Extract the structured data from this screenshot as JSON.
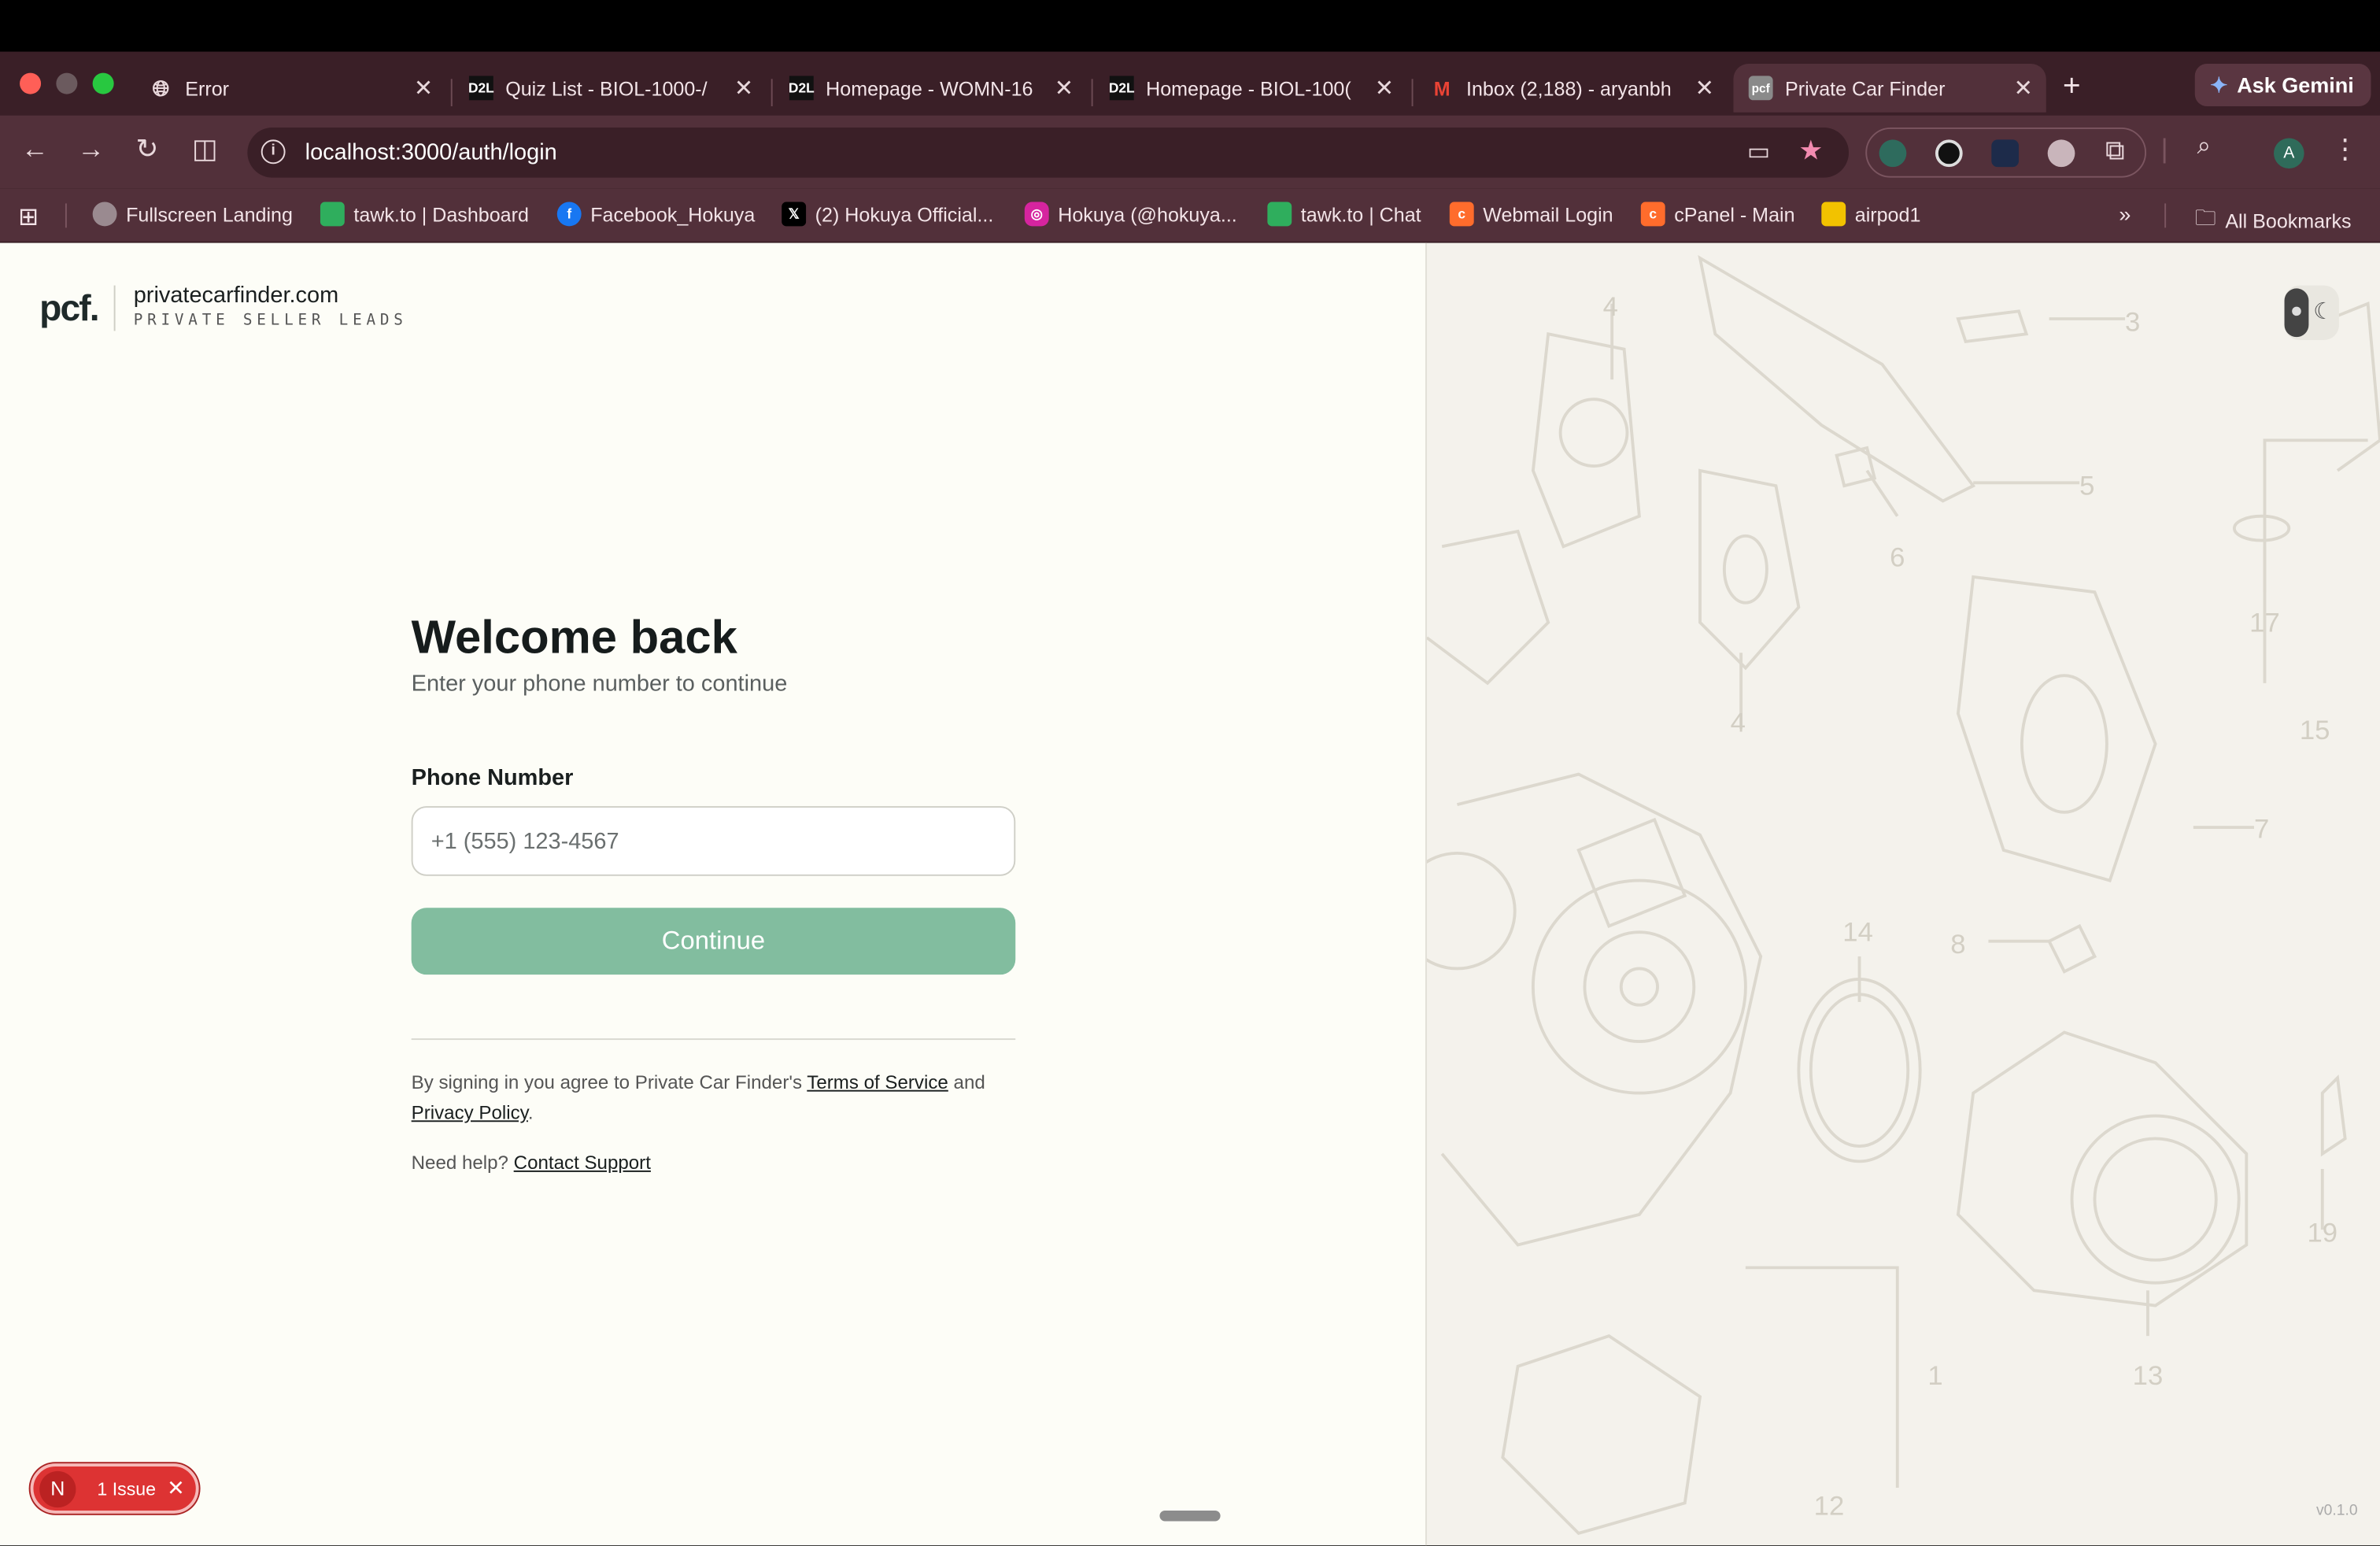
{
  "browser": {
    "tabs": [
      {
        "title": "Error",
        "favicon": "globe-icon"
      },
      {
        "title": "Quiz List - BIOL-1000-/",
        "favicon": "D2L"
      },
      {
        "title": "Homepage - WOMN-16",
        "favicon": "D2L"
      },
      {
        "title": "Homepage - BIOL-100(",
        "favicon": "D2L"
      },
      {
        "title": "Inbox (2,188) - aryanbh",
        "favicon": "M"
      },
      {
        "title": "Private Car Finder",
        "favicon": "pcf"
      }
    ],
    "ask_gemini": "Ask Gemini",
    "url": "localhost:3000/auth/login",
    "profile_initial": "A",
    "bookmarks": [
      {
        "label": "Fullscreen Landing",
        "color": "#9a8a90"
      },
      {
        "label": "tawk.to | Dashboard",
        "color": "#2fae5d"
      },
      {
        "label": "Facebook_Hokuya",
        "color": "#1877f2"
      },
      {
        "label": "(2) Hokuya Official...",
        "color": "#000000"
      },
      {
        "label": "Hokuya (@hokuya...",
        "color": "#d6249f"
      },
      {
        "label": "tawk.to | Chat",
        "color": "#2fae5d"
      },
      {
        "label": "Webmail Login",
        "color": "#ff6c2c"
      },
      {
        "label": "cPanel - Main",
        "color": "#ff6c2c"
      },
      {
        "label": "airpod1",
        "color": "#f2c200"
      }
    ],
    "all_bookmarks": "All Bookmarks"
  },
  "brand": {
    "mark": "pcf.",
    "domain": "privatecarfinder.com",
    "tagline": "PRIVATE SELLER LEADS"
  },
  "login": {
    "title": "Welcome back",
    "subtitle": "Enter your phone number to continue",
    "phone_label": "Phone Number",
    "phone_placeholder": "+1 (555) 123-4567",
    "continue_label": "Continue",
    "legal_prefix": "By signing in you agree to Private Car Finder's ",
    "terms_label": "Terms of Service",
    "legal_mid": " and ",
    "privacy_label": "Privacy Policy",
    "legal_suffix": ".",
    "help_prefix": "Need help? ",
    "support_label": "Contact Support"
  },
  "issue_badge": {
    "initial": "N",
    "text": "1 Issue"
  },
  "version": "v0.1.0",
  "diagram_numbers": [
    "4",
    "3",
    "5",
    "6",
    "4",
    "17",
    "15",
    "7",
    "14",
    "8",
    "1",
    "13",
    "12",
    "19"
  ],
  "colors": {
    "accent": "#82bd9f",
    "tab_bg": "#3a1f27",
    "toolbar_bg": "#52303a"
  }
}
